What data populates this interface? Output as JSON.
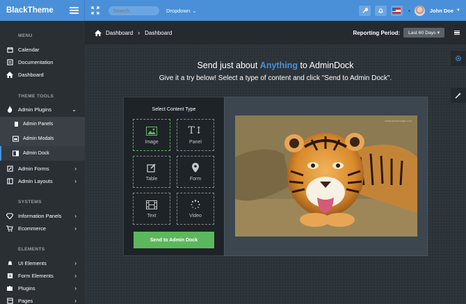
{
  "topbar": {
    "brand": "BlackTheme",
    "search_placeholder": "Search...",
    "dropdown_label": "Dropdown",
    "user_name": "John Doe"
  },
  "sidebar": {
    "sections": {
      "menu": "MENU",
      "theme_tools": "THEME TOOLS",
      "systems": "SYSTEMS",
      "elements": "ELEMENTS"
    },
    "menu_items": [
      "Calendar",
      "Documentation",
      "Dashboard"
    ],
    "theme_items": [
      "Admin Plugins",
      "Admin Forms",
      "Admin Layouts"
    ],
    "sub_items": [
      "Admin Panels",
      "Admin Modals",
      "Admin Dock"
    ],
    "system_items": [
      "Information Panels",
      "Ecommerce"
    ],
    "element_items": [
      "UI Elements",
      "Form Elements",
      "Plugins",
      "Pages"
    ]
  },
  "breadcrumb": {
    "root": "Dashboard",
    "current": "Dashboard"
  },
  "reporting": {
    "label": "Reporting Period:",
    "value": "Last 60 Days"
  },
  "headline": {
    "pre": "Send just about ",
    "highlight": "Anything",
    "post": " to AdminDock",
    "sub": "Give it a try below! Select a type of content and click \"Send to Admin Dock\"."
  },
  "picker": {
    "title": "Select Content Type",
    "tiles": [
      "Image",
      "Panel",
      "Table",
      "Form",
      "Text",
      "Video"
    ],
    "selected": "Image",
    "send_label": "Send to Admin Dock"
  },
  "preview": {
    "watermark": "www.stockimage.com"
  },
  "colors": {
    "accent": "#4a90d9",
    "success": "#5cb85c",
    "sidebar": "#2a2f34",
    "panel": "#1e2327"
  }
}
